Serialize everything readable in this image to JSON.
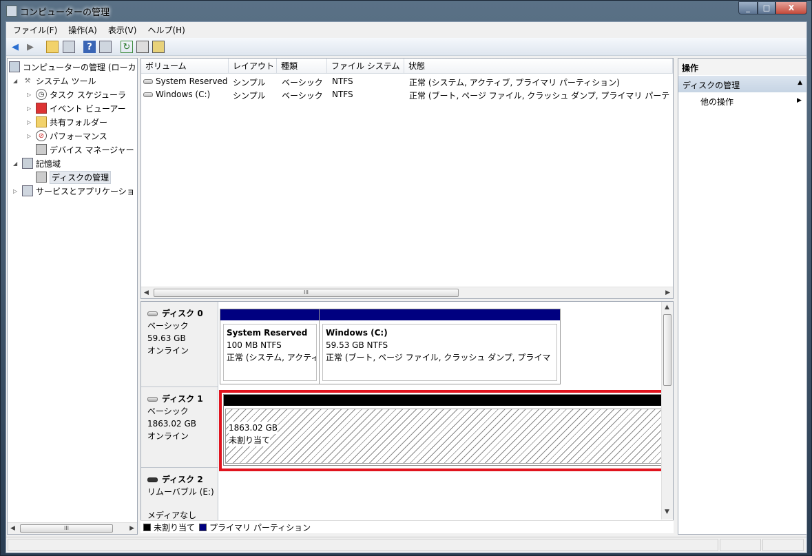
{
  "window": {
    "title": "コンピューターの管理",
    "min": "_",
    "max": "□",
    "close": "X"
  },
  "menu": [
    "ファイル(F)",
    "操作(A)",
    "表示(V)",
    "ヘルプ(H)"
  ],
  "tree": {
    "root": "コンピューターの管理 (ローカ",
    "system_tools": "システム ツール",
    "task_scheduler": "タスク スケジューラ",
    "event_viewer": "イベント ビューアー",
    "shared_folders": "共有フォルダー",
    "performance": "パフォーマンス",
    "device_manager": "デバイス マネージャー",
    "storage": "記憶域",
    "disk_management": "ディスクの管理",
    "services_apps": "サービスとアプリケーショ"
  },
  "volume_list": {
    "columns": [
      "ボリューム",
      "レイアウト",
      "種類",
      "ファイル システム",
      "状態"
    ],
    "rows": [
      {
        "volume": "System Reserved",
        "layout": "シンプル",
        "type": "ベーシック",
        "fs": "NTFS",
        "status": "正常 (システム, アクティブ, プライマリ パーティション)"
      },
      {
        "volume": "Windows (C:)",
        "layout": "シンプル",
        "type": "ベーシック",
        "fs": "NTFS",
        "status": "正常 (ブート, ページ ファイル, クラッシュ ダンプ, プライマリ パーテ"
      }
    ]
  },
  "disks": [
    {
      "name": "ディスク 0",
      "type": "ベーシック",
      "size": "59.63 GB",
      "state": "オンライン",
      "partitions": [
        {
          "name": "System Reserved",
          "size": "100 MB NTFS",
          "status": "正常 (システム, アクティ"
        },
        {
          "name": "Windows  (C:)",
          "size": "59.53 GB NTFS",
          "status": "正常 (ブート, ページ ファイル, クラッシュ ダンプ, プライマ"
        }
      ]
    },
    {
      "name": "ディスク 1",
      "type": "ベーシック",
      "size": "1863.02 GB",
      "state": "オンライン",
      "partitions": [
        {
          "size": "1863.02 GB",
          "status": "未割り当て"
        }
      ]
    },
    {
      "name": "ディスク 2",
      "type": "リムーバブル (E:)",
      "state": "メディアなし"
    }
  ],
  "legend": {
    "unallocated": "未割り当て",
    "primary": "プライマリ パーティション"
  },
  "actions": {
    "header": "操作",
    "section": "ディスクの管理",
    "more": "他の操作"
  },
  "colors": {
    "primary_partition": "#000080",
    "unallocated": "#000000",
    "highlight": "#e0141e"
  },
  "scroll_mark": "III"
}
